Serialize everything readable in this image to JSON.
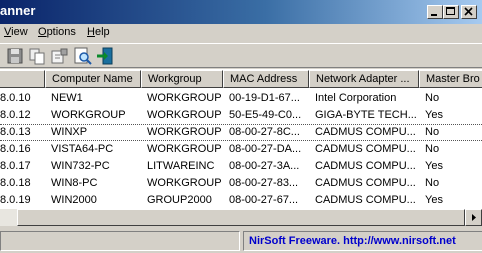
{
  "window": {
    "title": "anner"
  },
  "menu": {
    "view": {
      "underline": "V",
      "rest": "iew"
    },
    "options": {
      "underline": "O",
      "rest": "ptions"
    },
    "help": {
      "underline": "H",
      "rest": "elp"
    }
  },
  "toolbar": {
    "icons": [
      "save-icon",
      "copy-icon",
      "properties-icon",
      "find-icon",
      "exit-icon"
    ]
  },
  "table": {
    "headers": [
      "",
      "Computer Name",
      "Workgroup",
      "MAC Address",
      "Network Adapter ...",
      "Master Bro"
    ],
    "rows": [
      [
        "8.0.10",
        "NEW1",
        "WORKGROUP",
        "00-19-D1-67...",
        "Intel Corporation",
        "No"
      ],
      [
        "8.0.12",
        "WORKGROUP",
        "WORKGROUP",
        "50-E5-49-C0...",
        "GIGA-BYTE TECH...",
        "Yes"
      ],
      [
        "8.0.13",
        "WINXP",
        "WORKGROUP",
        "08-00-27-8C...",
        "CADMUS COMPU...",
        "No"
      ],
      [
        "8.0.16",
        "VISTA64-PC",
        "WORKGROUP",
        "08-00-27-DA...",
        "CADMUS COMPU...",
        "No"
      ],
      [
        "8.0.17",
        "WIN732-PC",
        "LITWAREINC",
        "08-00-27-3A...",
        "CADMUS COMPU...",
        "Yes"
      ],
      [
        "8.0.18",
        "WIN8-PC",
        "WORKGROUP",
        "08-00-27-83...",
        "CADMUS COMPU...",
        "No"
      ],
      [
        "8.0.19",
        "WIN2000",
        "GROUP2000",
        "08-00-27-67...",
        "CADMUS COMPU...",
        "Yes"
      ]
    ]
  },
  "status": {
    "link": "NirSoft Freeware.  http://www.nirsoft.net"
  },
  "colors": {
    "title_start": "#0a246a",
    "title_end": "#a6caf0",
    "link": "#0000cc"
  }
}
